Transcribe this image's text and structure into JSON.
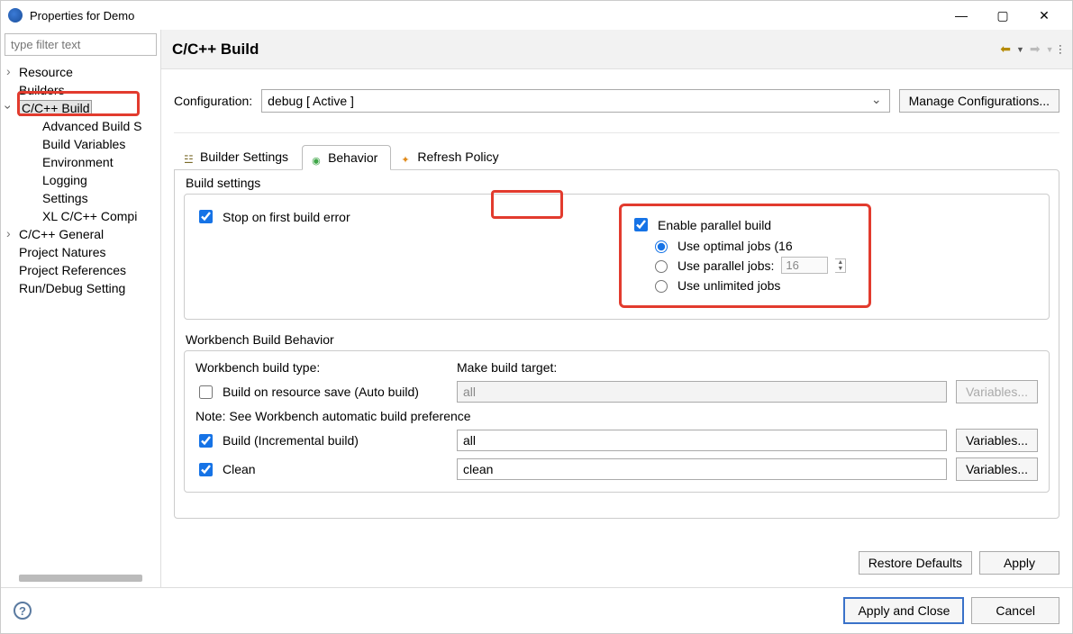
{
  "window": {
    "title": "Properties for Demo"
  },
  "filter_placeholder": "type filter text",
  "tree": {
    "resource": "Resource",
    "builders": "Builders",
    "ccbuild": "C/C++ Build",
    "adv": "Advanced Build Settings...",
    "adv_short": "Advanced Build S",
    "vars": "Build Variables",
    "env": "Environment",
    "logging": "Logging",
    "settings": "Settings",
    "xlc": "XL C/C++ Compi",
    "ccgeneral": "C/C++ General",
    "natures": "Project Natures",
    "refs": "Project References",
    "rundebug": "Run/Debug Setting"
  },
  "page": {
    "title": "C/C++ Build"
  },
  "config": {
    "label": "Configuration:",
    "value": "debug  [ Active ]",
    "manage": "Manage Configurations..."
  },
  "tabs": {
    "builder": "Builder Settings",
    "behavior": "Behavior",
    "refresh": "Refresh Policy"
  },
  "build_settings": {
    "group": "Build settings",
    "stop": "Stop on first build error",
    "enable_parallel": "Enable parallel build",
    "optimal": "Use optimal jobs (16",
    "parallel_jobs": "Use parallel jobs:",
    "parallel_jobs_value": "16",
    "unlimited": "Use unlimited jobs"
  },
  "workbench": {
    "group": "Workbench Build Behavior",
    "type": "Workbench build type:",
    "target": "Make build target:",
    "auto": "Build on resource save (Auto build)",
    "auto_target": "all",
    "note": "Note: See Workbench automatic build preference",
    "incremental": "Build (Incremental build)",
    "incremental_target": "all",
    "clean": "Clean",
    "clean_target": "clean",
    "vars_btn": "Variables..."
  },
  "buttons": {
    "restore": "Restore Defaults",
    "apply": "Apply",
    "apply_close": "Apply and Close",
    "cancel": "Cancel"
  }
}
